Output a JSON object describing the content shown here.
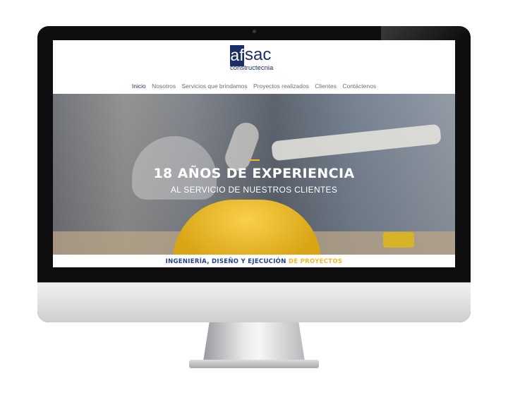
{
  "logo": {
    "mark": "af",
    "name": "sac",
    "subtitle": "constructecnia"
  },
  "nav": {
    "items": [
      "Inicio",
      "Nosotros",
      "Servicios que brindamos",
      "Proyectos realizados",
      "Clientes",
      "Contáctenos"
    ]
  },
  "hero": {
    "title": "18 AÑOS DE EXPERIENCIA",
    "subtitle": "AL SERVICIO DE NUESTROS CLIENTES"
  },
  "tagline": {
    "main": "INGENIERÍA, DISEÑO Y EJECUCIÓN",
    "highlight": "DE PROYECTOS"
  },
  "colors": {
    "brand": "#1c2e66",
    "accent": "#f2b829",
    "tagline": "#1f3f8f"
  }
}
